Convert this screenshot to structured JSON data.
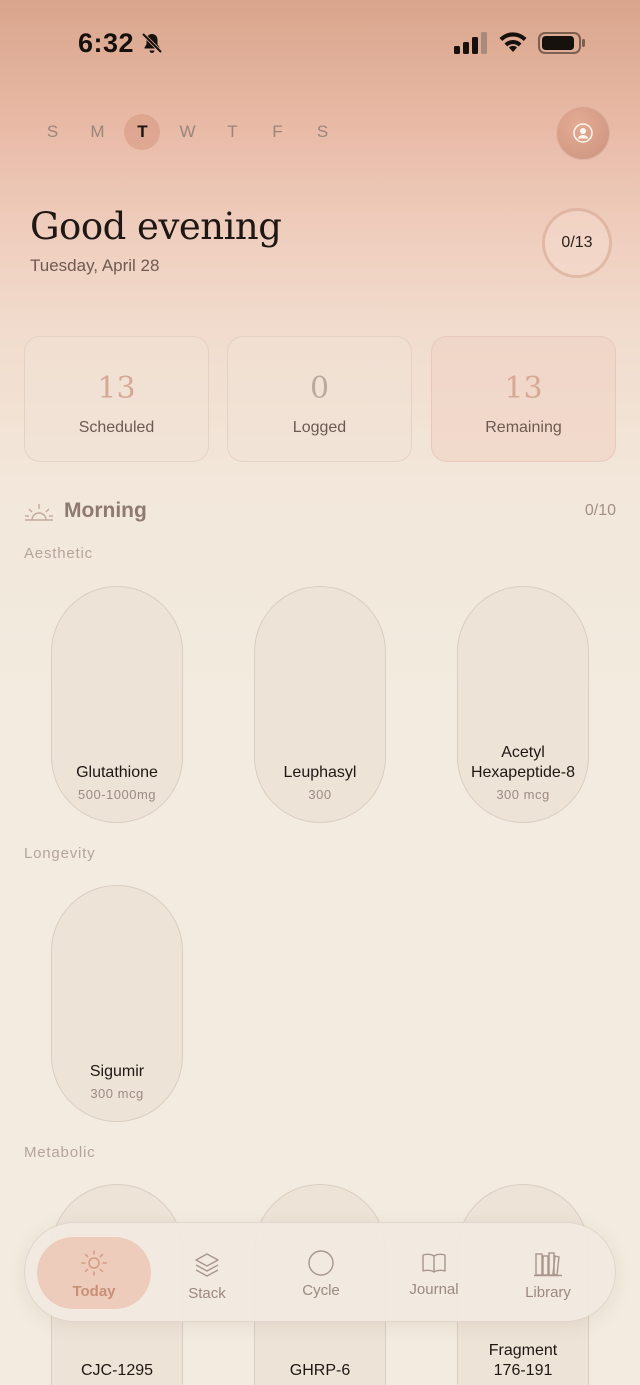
{
  "status_bar": {
    "time": "6:32"
  },
  "week": {
    "days": [
      "S",
      "M",
      "T",
      "W",
      "T",
      "F",
      "S"
    ],
    "active_index": 2
  },
  "header": {
    "greeting": "Good evening",
    "date": "Tuesday, April 28",
    "progress": "0/13"
  },
  "stats": {
    "scheduled": {
      "value": "13",
      "label": "Scheduled"
    },
    "logged": {
      "value": "0",
      "label": "Logged"
    },
    "remaining": {
      "value": "13",
      "label": "Remaining"
    }
  },
  "morning": {
    "title": "Morning",
    "count": "0/10",
    "groups": [
      {
        "label": "Aesthetic",
        "items": [
          {
            "name": "Glutathione",
            "dose": "500-1000mg"
          },
          {
            "name": "Leuphasyl",
            "dose": "300"
          },
          {
            "name_line1": "Acetyl",
            "name_line2": "Hexapeptide-8",
            "dose": "300 mcg"
          }
        ]
      },
      {
        "label": "Longevity",
        "items": [
          {
            "name": "Sigumir",
            "dose": "300 mcg"
          }
        ]
      },
      {
        "label": "Metabolic",
        "items": [
          {
            "name": "CJC-1295"
          },
          {
            "name": "GHRP-6"
          },
          {
            "name_line1": "Fragment",
            "name_line2": "176-191"
          }
        ]
      }
    ]
  },
  "nav": {
    "items": [
      {
        "label": "Today",
        "icon": "sun-icon",
        "active": true
      },
      {
        "label": "Stack",
        "icon": "layers-icon"
      },
      {
        "label": "Cycle",
        "icon": "circle-icon"
      },
      {
        "label": "Journal",
        "icon": "book-icon"
      },
      {
        "label": "Library",
        "icon": "books-icon"
      }
    ]
  },
  "colors": {
    "accent": "#d6a996",
    "nav_active": "#c88f76",
    "pill_bg": "#ede3d7",
    "background": "#f3ebdf"
  }
}
